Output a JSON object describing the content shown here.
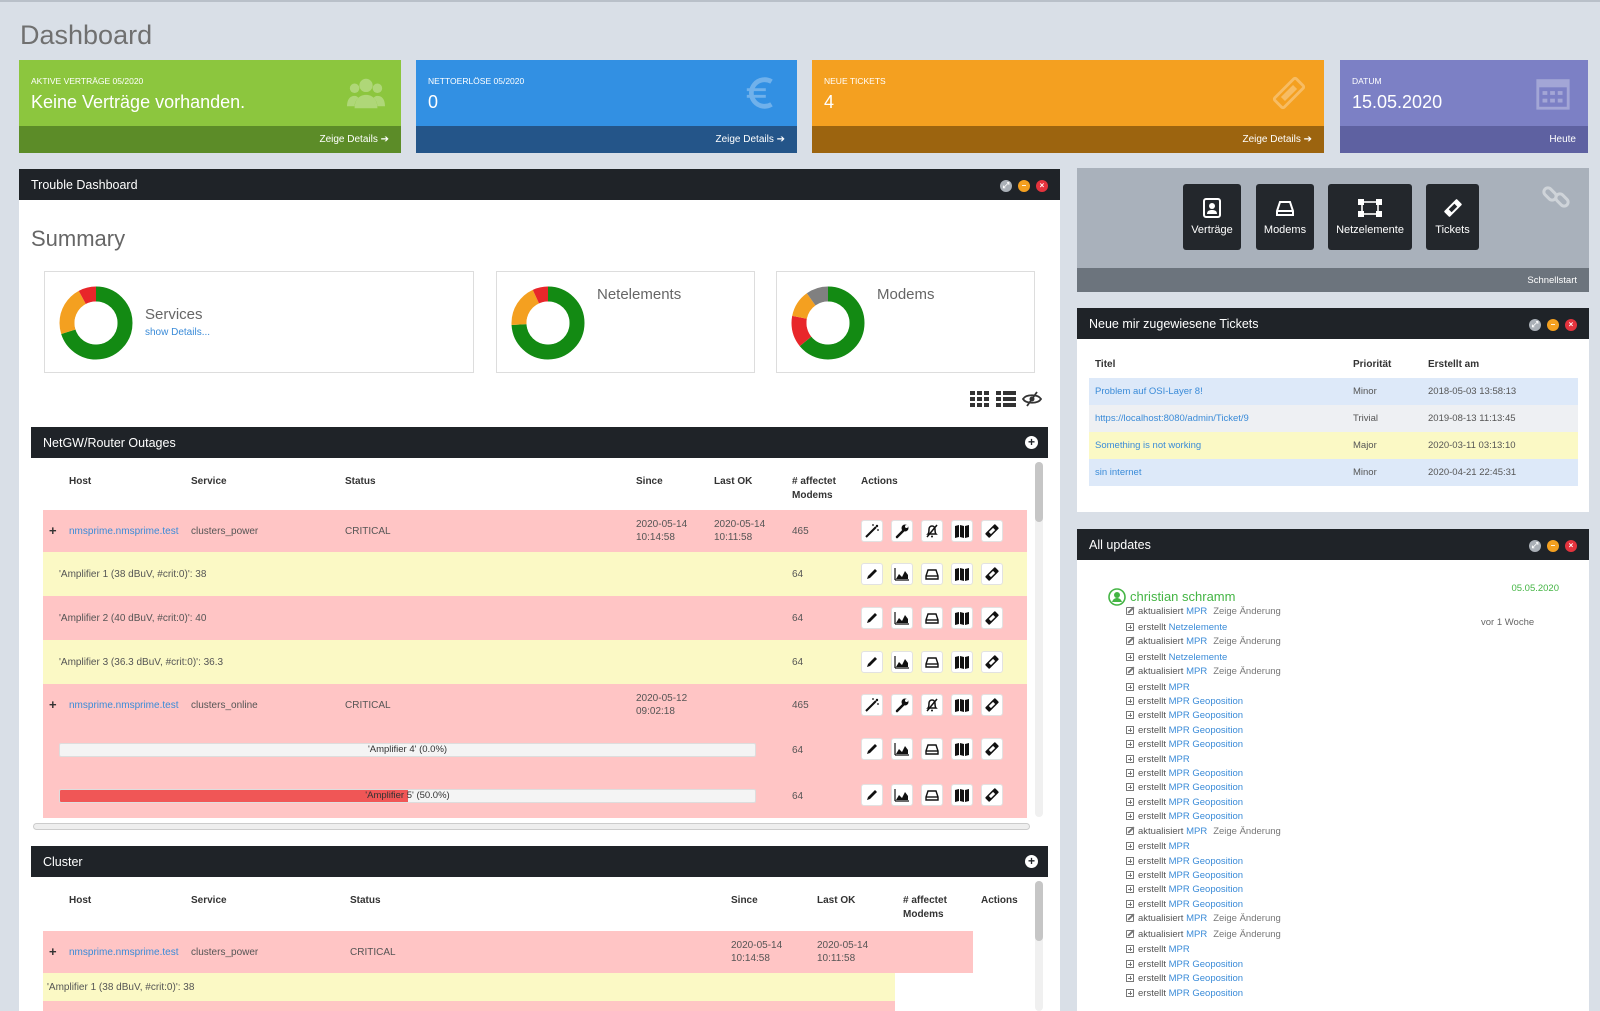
{
  "page": {
    "title": "Dashboard"
  },
  "stats": [
    {
      "label": "AKTIVE VERTRÄGE 05/2020",
      "value": "Keine Verträge vorhanden.",
      "footer": "Zeige Details",
      "icon": "users-icon",
      "color": "#8cc63e"
    },
    {
      "label": "NETTOERLÖSE 05/2020",
      "value": "0",
      "footer": "Zeige Details",
      "icon": "euro-icon",
      "color": "#3290e3"
    },
    {
      "label": "NEUE TICKETS",
      "value": "4",
      "footer": "Zeige Details",
      "icon": "ticket-icon",
      "color": "#f4a020"
    },
    {
      "label": "DATUM",
      "value": "15.05.2020",
      "footer": "Heute",
      "icon": "calendar-icon",
      "color": "#7c80c5"
    }
  ],
  "trouble": {
    "title": "Trouble Dashboard",
    "summary_title": "Summary",
    "boxes": [
      {
        "title": "Services",
        "link": "show Details...",
        "slices": [
          {
            "value": 70,
            "color": "#138a13"
          },
          {
            "value": 22,
            "color": "#f4a020"
          },
          {
            "value": 8,
            "color": "#e8262a"
          }
        ]
      },
      {
        "title": "Netelements",
        "link": "",
        "slices": [
          {
            "value": 74,
            "color": "#138a13"
          },
          {
            "value": 19,
            "color": "#f4a020"
          },
          {
            "value": 7,
            "color": "#e8262a"
          }
        ]
      },
      {
        "title": "Modems",
        "link": "",
        "slices": [
          {
            "value": 64,
            "color": "#138a13"
          },
          {
            "value": 14,
            "color": "#e8262a"
          },
          {
            "value": 12,
            "color": "#f4a020"
          },
          {
            "value": 10,
            "color": "#808080"
          }
        ]
      }
    ],
    "outages": {
      "title": "NetGW/Router Outages",
      "headers": {
        "host": "Host",
        "service": "Service",
        "status": "Status",
        "since": "Since",
        "last_ok": "Last OK",
        "affected": "# affectet Modems",
        "actions": "Actions"
      },
      "rows": [
        {
          "expand": "+",
          "host": "nmsprime.nmsprime.test",
          "service": "clusters_power",
          "status": "CRITICAL",
          "since": "2020-05-14 10:14:58",
          "last_ok": "2020-05-14 10:11:58",
          "affected": "465"
        },
        {
          "label": "'Amplifier 1 (38 dBuV, #crit:0)': 38",
          "affected": "64"
        },
        {
          "label": "'Amplifier 2 (40 dBuV, #crit:0)': 40",
          "affected": "64"
        },
        {
          "label": "'Amplifier 3 (36.3 dBuV, #crit:0)': 36.3",
          "affected": "64"
        },
        {
          "expand": "+",
          "host": "nmsprime.nmsprime.test",
          "service": "clusters_online",
          "status": "CRITICAL",
          "since": "2020-05-12 09:02:18",
          "last_ok": "",
          "affected": "465"
        },
        {
          "bar_label": "'Amplifier 4' (0.0%)",
          "fraction": 0.0,
          "affected": "64"
        },
        {
          "bar_label": "'Amplifier 5' (50.0%)",
          "fraction": 0.5,
          "affected": "64"
        }
      ]
    },
    "cluster": {
      "title": "Cluster",
      "headers": {
        "host": "Host",
        "service": "Service",
        "status": "Status",
        "since": "Since",
        "last_ok": "Last OK",
        "affected": "# affectet Modems",
        "actions": "Actions"
      },
      "rows": [
        {
          "expand": "+",
          "host": "nmsprime.nmsprime.test",
          "service": "clusters_power",
          "status": "CRITICAL",
          "since": "2020-05-14 10:14:58",
          "last_ok": "2020-05-14 10:11:58"
        },
        {
          "label": "'Amplifier 1 (38 dBuV, #crit:0)': 38"
        }
      ]
    }
  },
  "quickstart": {
    "tiles": [
      {
        "label": "Verträge",
        "icon": "contract-icon"
      },
      {
        "label": "Modems",
        "icon": "modem-icon"
      },
      {
        "label": "Netzelemente",
        "icon": "network-icon"
      },
      {
        "label": "Tickets",
        "icon": "ticket-icon"
      }
    ],
    "footer": "Schnellstart",
    "corner_icon": "link-icon"
  },
  "tickets": {
    "title": "Neue mir zugewiesene Tickets",
    "headers": {
      "title": "Titel",
      "priority": "Priorität",
      "created": "Erstellt am"
    },
    "rows": [
      {
        "title": "Problem auf OSI-Layer 8!",
        "priority": "Minor",
        "created": "2018-05-03 13:58:13"
      },
      {
        "title": "https://localhost:8080/admin/Ticket/9",
        "priority": "Trivial",
        "created": "2019-08-13 11:13:45"
      },
      {
        "title": "Something is not working",
        "priority": "Major",
        "created": "2020-03-11 03:13:10"
      },
      {
        "title": "sin internet",
        "priority": "Minor",
        "created": "2020-04-21 22:45:31"
      }
    ]
  },
  "updates": {
    "title": "All updates",
    "user": "christian schramm",
    "date": "05.05.2020",
    "ago": "vor 1 Woche",
    "items": [
      {
        "type": "edit",
        "verb": "aktualisiert",
        "link": "MPR",
        "extra": "Zeige Änderung"
      },
      {
        "type": "add",
        "verb": "erstellt",
        "link": "Netzelemente",
        "extra": ""
      },
      {
        "type": "edit",
        "verb": "aktualisiert",
        "link": "MPR",
        "extra": "Zeige Änderung"
      },
      {
        "type": "add",
        "verb": "erstellt",
        "link": "Netzelemente",
        "extra": ""
      },
      {
        "type": "edit",
        "verb": "aktualisiert",
        "link": "MPR",
        "extra": "Zeige Änderung"
      },
      {
        "type": "add",
        "verb": "erstellt",
        "link": "MPR",
        "extra": ""
      },
      {
        "type": "add",
        "verb": "erstellt",
        "link": "MPR Geoposition",
        "extra": ""
      },
      {
        "type": "add",
        "verb": "erstellt",
        "link": "MPR Geoposition",
        "extra": ""
      },
      {
        "type": "add",
        "verb": "erstellt",
        "link": "MPR Geoposition",
        "extra": ""
      },
      {
        "type": "add",
        "verb": "erstellt",
        "link": "MPR Geoposition",
        "extra": ""
      },
      {
        "type": "add",
        "verb": "erstellt",
        "link": "MPR",
        "extra": ""
      },
      {
        "type": "add",
        "verb": "erstellt",
        "link": "MPR Geoposition",
        "extra": ""
      },
      {
        "type": "add",
        "verb": "erstellt",
        "link": "MPR Geoposition",
        "extra": ""
      },
      {
        "type": "add",
        "verb": "erstellt",
        "link": "MPR Geoposition",
        "extra": ""
      },
      {
        "type": "add",
        "verb": "erstellt",
        "link": "MPR Geoposition",
        "extra": ""
      },
      {
        "type": "edit",
        "verb": "aktualisiert",
        "link": "MPR",
        "extra": "Zeige Änderung"
      },
      {
        "type": "add",
        "verb": "erstellt",
        "link": "MPR",
        "extra": ""
      },
      {
        "type": "add",
        "verb": "erstellt",
        "link": "MPR Geoposition",
        "extra": ""
      },
      {
        "type": "add",
        "verb": "erstellt",
        "link": "MPR Geoposition",
        "extra": ""
      },
      {
        "type": "add",
        "verb": "erstellt",
        "link": "MPR Geoposition",
        "extra": ""
      },
      {
        "type": "add",
        "verb": "erstellt",
        "link": "MPR Geoposition",
        "extra": ""
      },
      {
        "type": "edit",
        "verb": "aktualisiert",
        "link": "MPR",
        "extra": "Zeige Änderung"
      },
      {
        "type": "edit",
        "verb": "aktualisiert",
        "link": "MPR",
        "extra": "Zeige Änderung"
      },
      {
        "type": "add",
        "verb": "erstellt",
        "link": "MPR",
        "extra": ""
      },
      {
        "type": "add",
        "verb": "erstellt",
        "link": "MPR Geoposition",
        "extra": ""
      },
      {
        "type": "add",
        "verb": "erstellt",
        "link": "MPR Geoposition",
        "extra": ""
      },
      {
        "type": "add",
        "verb": "erstellt",
        "link": "MPR Geoposition",
        "extra": ""
      }
    ]
  }
}
